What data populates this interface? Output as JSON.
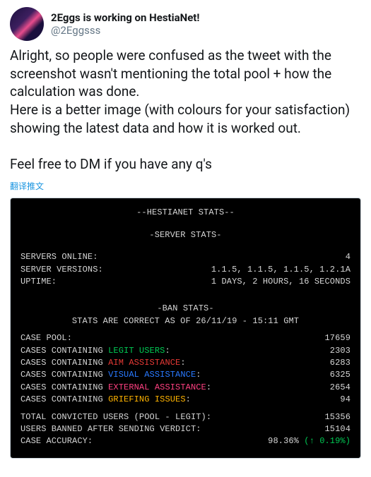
{
  "user": {
    "display_name": "2Eggs is working on HestiaNet!",
    "handle": "@2Eggsss"
  },
  "tweet_text": "Alright, so people were confused as the tweet with the screenshot wasn't mentioning the total pool + how the calculation was done.\nHere is a better image (with colours for your satisfaction) showing the latest data and how it is worked out.\n\nFeel free to DM if you have any q's",
  "translate_label": "翻译推文",
  "terminal": {
    "title": "--HESTIANET STATS--",
    "server_header": "-SERVER STATS-",
    "servers_online_label": "SERVERS ONLINE:",
    "servers_online_value": "4",
    "server_versions_label": "SERVER VERSIONS:",
    "server_versions_value": "1.1.5, 1.1.5, 1.1.5, 1.2.1A",
    "uptime_label": "UPTIME:",
    "uptime_value": "1 DAYS, 2 HOURS, 16 SECONDS",
    "ban_header": "-BAN STATS-",
    "ban_correct": "STATS ARE CORRECT AS OF 26/11/19 - 15:11 GMT",
    "case_pool_label": "CASE POOL:",
    "case_pool_value": "17659",
    "cases_prefix": "CASES CONTAINING ",
    "legit_label": "LEGIT USERS",
    "legit_value": "2303",
    "aim_label": "AIM ASSISTANCE",
    "aim_value": "6283",
    "visual_label": "VISUAL ASSISTANCE",
    "visual_value": "6325",
    "external_label": "EXTERNAL ASSISTANCE",
    "external_value": "2654",
    "griefing_label": "GRIEFING ISSUES",
    "griefing_value": "94",
    "colon": ":",
    "convicted_label": "TOTAL CONVICTED USERS (POOL - LEGIT):",
    "convicted_value": "15356",
    "banned_label": "USERS BANNED AFTER SENDING VERDICT:",
    "banned_value": "15104",
    "accuracy_label": "CASE ACCURACY:",
    "accuracy_value": "98.36%",
    "accuracy_delta": " (↑ 0.19%)"
  }
}
